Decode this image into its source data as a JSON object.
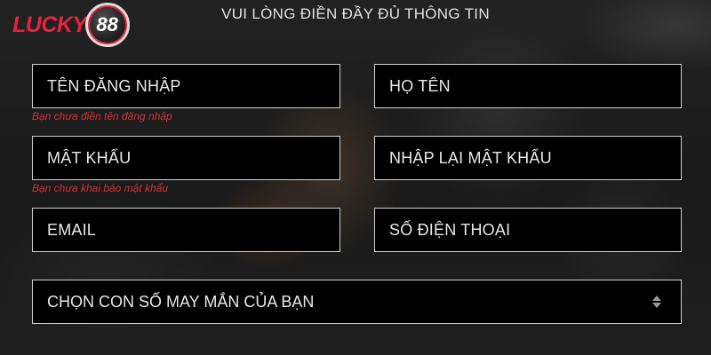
{
  "logo": {
    "text": "LUCKY",
    "badge": "88",
    "brand_color": "#e8223d"
  },
  "form": {
    "heading": "VUI LÒNG ĐIỀN ĐẦY ĐỦ THÔNG TIN",
    "fields": {
      "username": {
        "placeholder": "TÊN ĐĂNG NHẬP",
        "error": "Bạn chưa điền tên đăng nhập"
      },
      "fullname": {
        "placeholder": "HỌ TÊN"
      },
      "password": {
        "placeholder": "MẬT KHẨU",
        "error": "Bạn chưa khai báo mật khẩu"
      },
      "password_confirm": {
        "placeholder": "NHẬP LẠI MẬT KHẨU"
      },
      "email": {
        "placeholder": "EMAIL"
      },
      "phone": {
        "placeholder": "SỐ ĐIỆN THOẠI"
      }
    },
    "lucky_number_select": {
      "selected": "CHỌN CON SỐ MAY MẮN CỦA BẠN",
      "icon": "updown-arrows-icon"
    }
  },
  "colors": {
    "error": "#d43232",
    "field_bg": "#000000",
    "field_border": "#cfcfcf"
  }
}
